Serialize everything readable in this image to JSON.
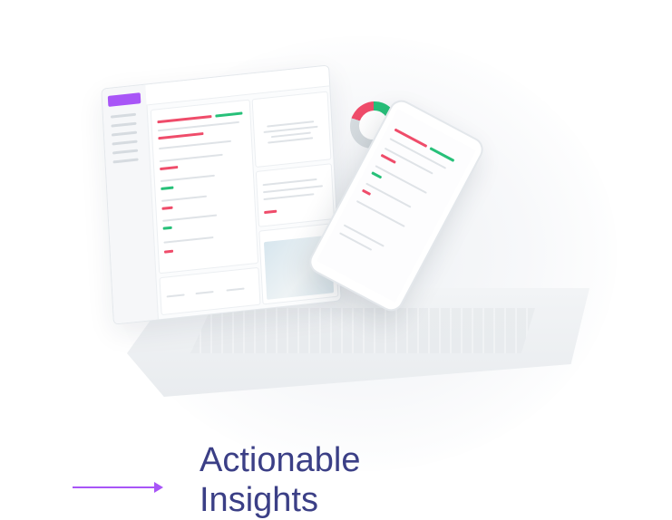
{
  "caption": {
    "line1": "Actionable",
    "line2": "Insights"
  },
  "colors": {
    "accent": "#a855f7",
    "text": "#3b3f86",
    "positive": "#27c079",
    "negative": "#ef4c6a"
  },
  "icons": {
    "arrow": "arrow-right-icon"
  }
}
